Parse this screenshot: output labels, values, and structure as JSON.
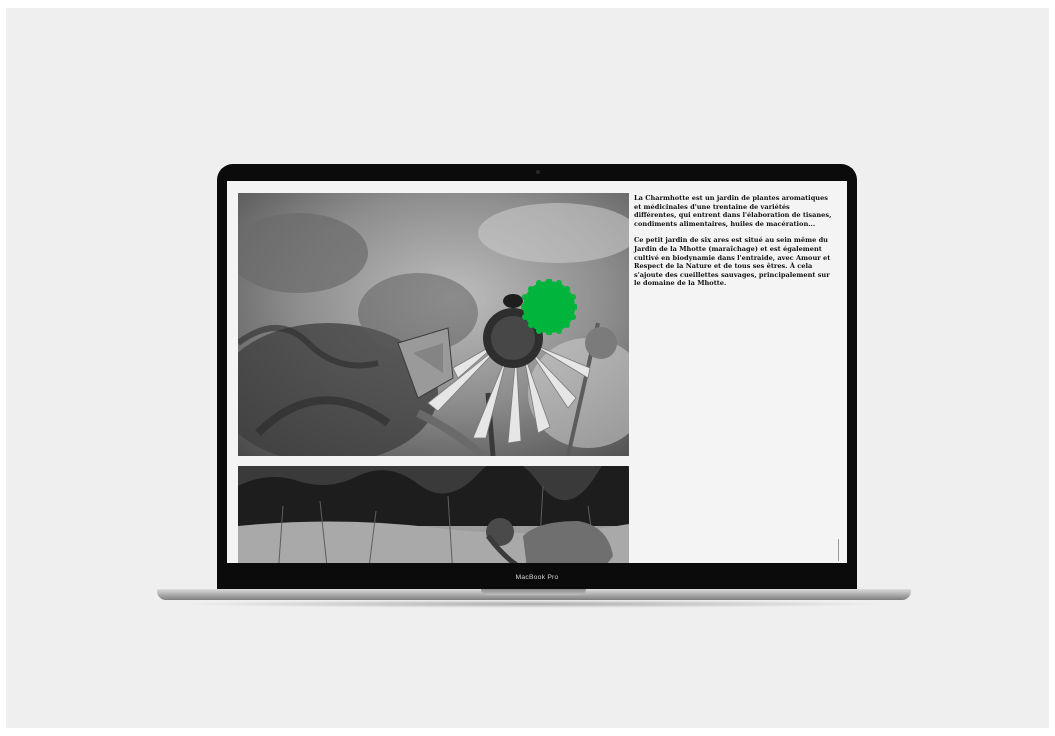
{
  "laptop": {
    "model_label": "MacBook Pro"
  },
  "page": {
    "paragraphs": [
      "La Charmhotte est un jardin de plantes aromatiques et médicinales d'une trentaine de variétés différentes, qui entrent dans l'élaboration de tisanes, condiments alimentaires, huiles de macération...",
      "Ce petit jardin de six ares est situé au sein même du Jardin de la Mhotte (maraîchage) et est également cultivé en biodynamie dans l'entraide, avec Amour et Respect de la Nature et de tous ses êtres. À cela s'ajoute des cueillettes sauvages, principalement sur le domaine de la Mhotte."
    ],
    "badge_color": "#00b43c"
  }
}
